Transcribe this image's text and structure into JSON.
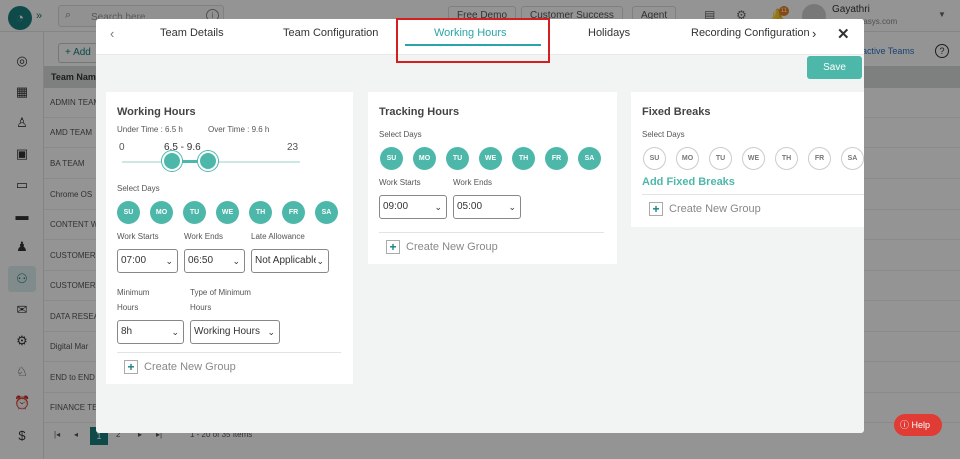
{
  "header": {
    "logo_glyph": "◔",
    "expand_glyph": "»",
    "search_placeholder": "Search here...",
    "buttons": [
      "Free Demo",
      "Customer Success",
      "Agent"
    ],
    "notification_count": "11",
    "user_name": "Gayathri",
    "user_email_fragment": "esnovasys.com"
  },
  "page": {
    "add_label": "+ Add",
    "inactive_teams_label": "active Teams",
    "table_header": "Team Nam",
    "rows": [
      "ADMIN TEAM",
      "AMD TEAM",
      "BA TEAM",
      "Chrome OS",
      "CONTENT W",
      "CUSTOMER",
      "CUSTOMER",
      "DATA RESEA",
      "Digital Mar",
      "END to END",
      "FINANCE TE"
    ],
    "pager": {
      "pages": [
        "1",
        "2"
      ],
      "summary": "1 - 20 of 35 Items"
    }
  },
  "modal": {
    "tabs": [
      "Team Details",
      "Team Configuration",
      "Working Hours",
      "Holidays",
      "Recording Configuration"
    ],
    "active_tab": "Working Hours",
    "save_label": "Save",
    "working_hours": {
      "title": "Working Hours",
      "under_time": "Under Time : 6.5 h",
      "over_time": "Over Time : 9.6 h",
      "slider_min": "0",
      "slider_max": "23",
      "slider_range": "6.5 - 9.6",
      "range_low": 6.5,
      "range_high": 9.6,
      "select_days_label": "Select Days",
      "days": [
        "SU",
        "MO",
        "TU",
        "WE",
        "TH",
        "FR",
        "SA"
      ],
      "work_starts_label": "Work Starts",
      "work_ends_label": "Work Ends",
      "late_allowance_label": "Late Allowance",
      "work_starts": "07:00",
      "work_ends": "06:50",
      "late_allowance": "Not Applicable",
      "minimum_hours_label": "Minimum",
      "minimum_hours_label2": "Hours",
      "type_min_label": "Type of Minimum",
      "type_min_label2": "Hours",
      "minimum_hours": "8h",
      "type_min": "Working Hours",
      "create_group": "Create New Group"
    },
    "tracking_hours": {
      "title": "Tracking Hours",
      "select_days_label": "Select Days",
      "days": [
        "SU",
        "MO",
        "TU",
        "WE",
        "TH",
        "FR",
        "SA"
      ],
      "work_starts_label": "Work Starts",
      "work_ends_label": "Work Ends",
      "work_starts": "09:00",
      "work_ends": "05:00",
      "create_group": "Create New Group"
    },
    "fixed_breaks": {
      "title": "Fixed Breaks",
      "select_days_label": "Select Days",
      "days": [
        "SU",
        "MO",
        "TU",
        "WE",
        "TH",
        "FR",
        "SA"
      ],
      "add_label": "Add Fixed Breaks",
      "create_group": "Create New Group"
    }
  },
  "help_label": "Help",
  "colors": {
    "accent": "#4db8aa",
    "brand": "#17807f",
    "highlight": "#d31f1f",
    "help": "#e03b34"
  }
}
